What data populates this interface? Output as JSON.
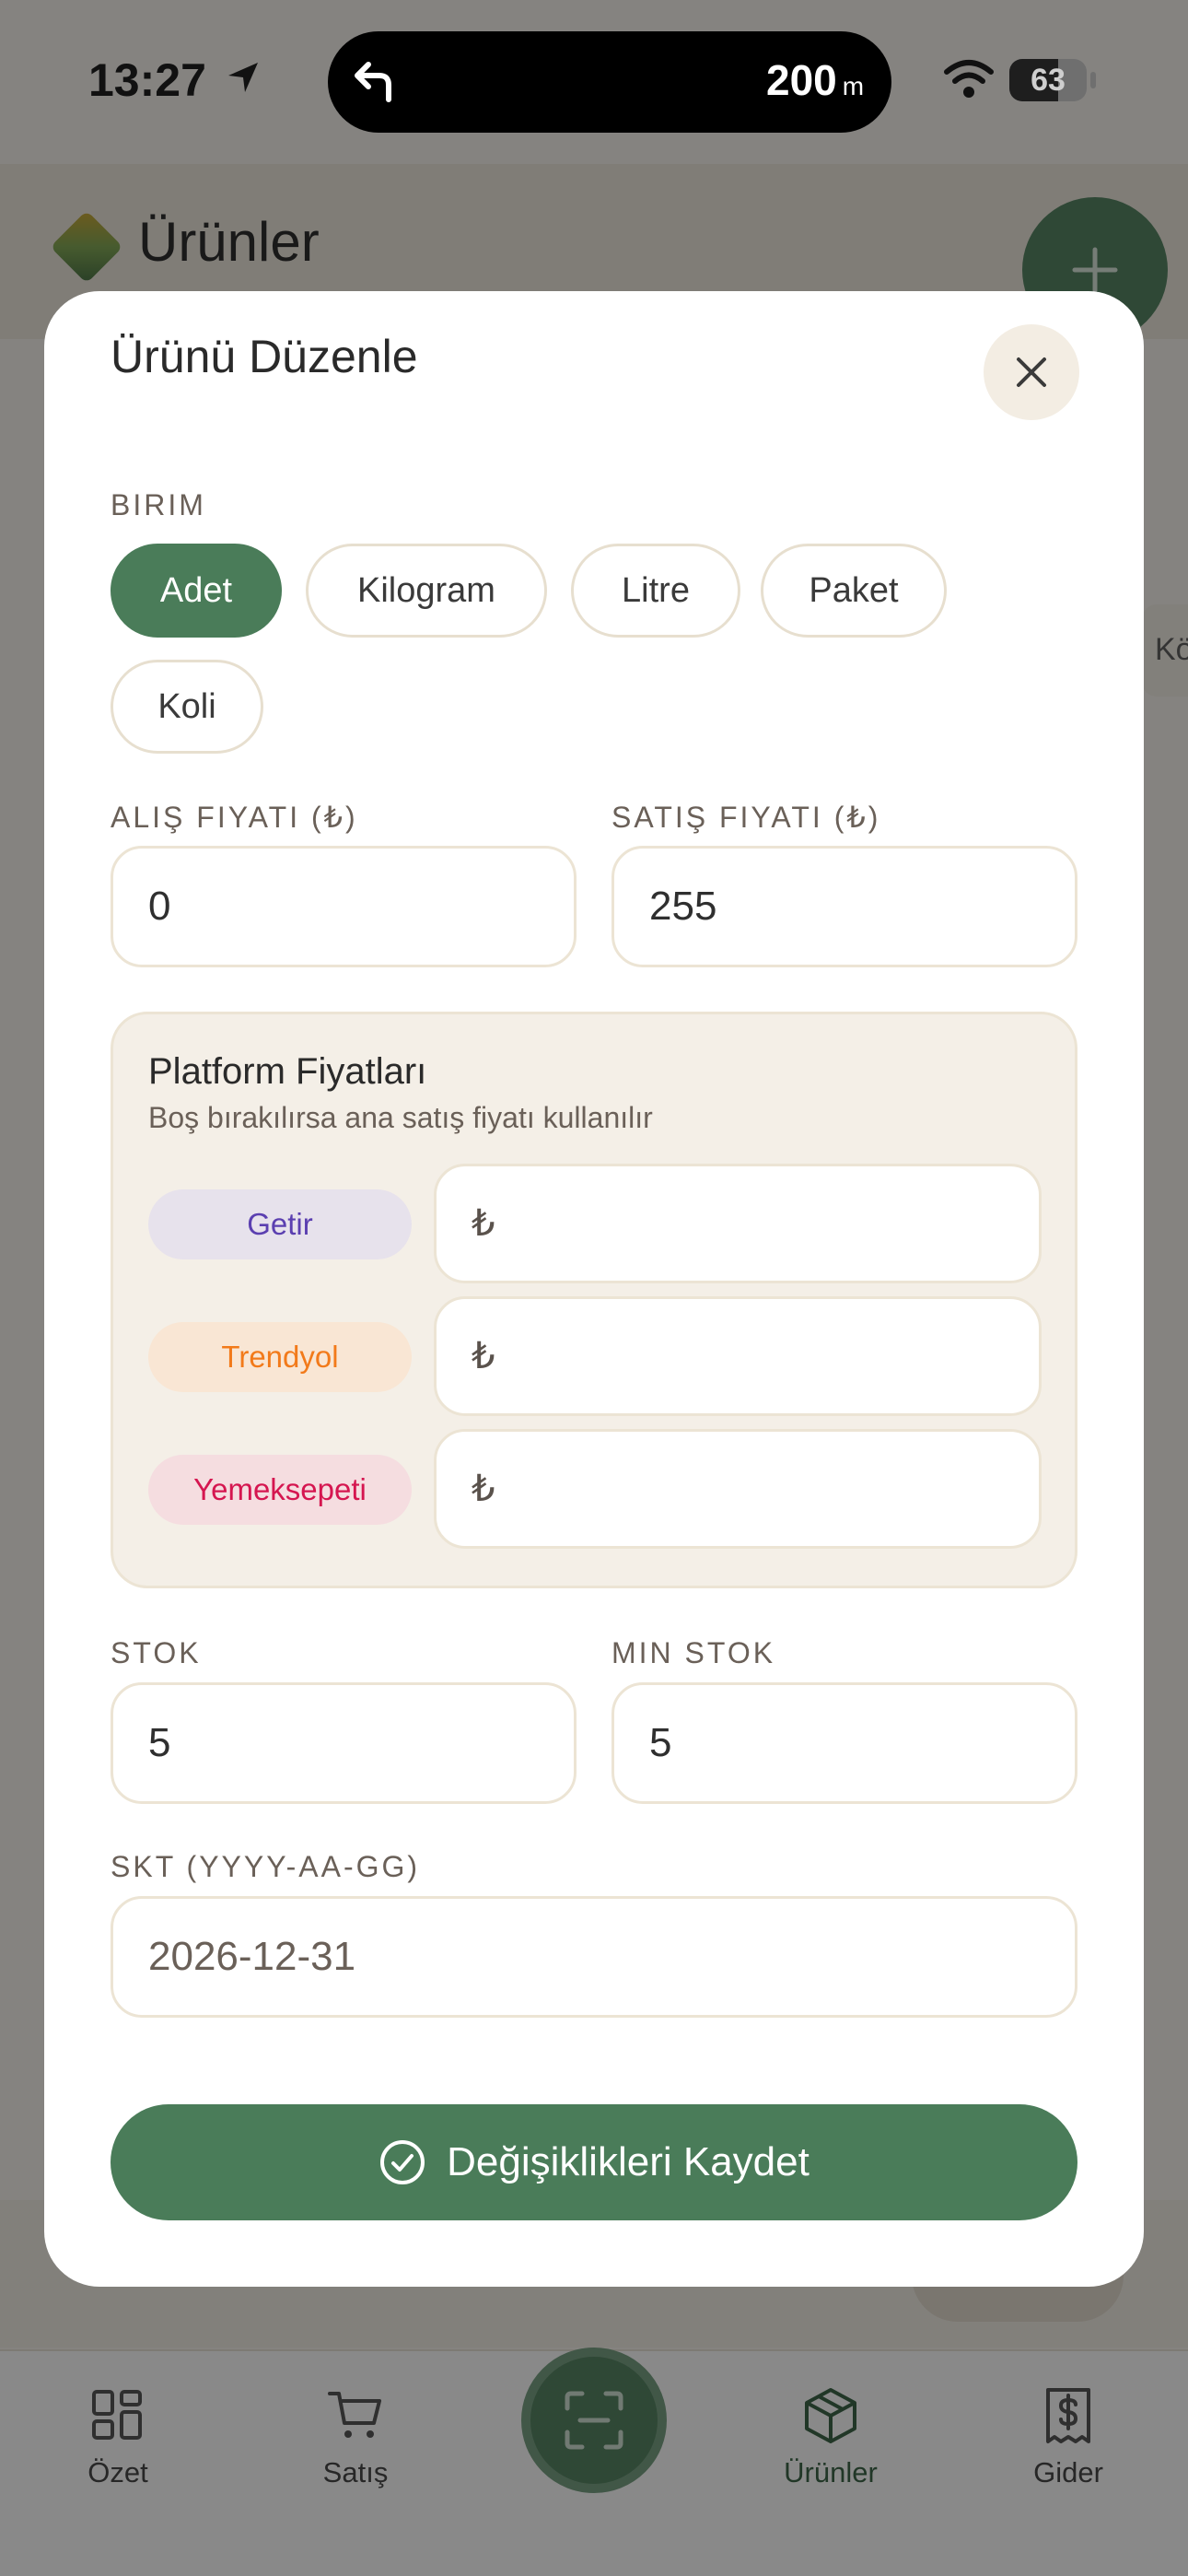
{
  "status_bar": {
    "time": "13:27",
    "nav_distance": "200",
    "nav_unit": "m",
    "battery": "63",
    "battery_fraction": 0.63
  },
  "background": {
    "header_title": "Ürünler",
    "peek_text": "Kö",
    "nav": [
      {
        "label": "Özet",
        "icon": "grid-icon"
      },
      {
        "label": "Satış",
        "icon": "cart-icon"
      },
      {
        "label": "",
        "icon": "scan-icon"
      },
      {
        "label": "Ürünler",
        "icon": "box-icon",
        "active": true
      },
      {
        "label": "Gider",
        "icon": "receipt-icon"
      }
    ]
  },
  "modal": {
    "title": "Ürünü Düzenle",
    "unit_label": "BIRIM",
    "units": [
      "Adet",
      "Kilogram",
      "Litre",
      "Paket",
      "Koli"
    ],
    "selected_unit": "Adet",
    "purchase_price_label": "ALIŞ FIYATI (₺)",
    "purchase_price": "0",
    "sale_price_label": "SATIŞ FIYATI (₺)",
    "sale_price": "255",
    "platform": {
      "title": "Platform Fiyatları",
      "subtitle": "Boş bırakılırsa ana satış fiyatı kullanılır",
      "items": [
        {
          "name": "Getir",
          "currency": "₺",
          "color": "#5b3fb0",
          "bg": "#e7e2ec"
        },
        {
          "name": "Trendyol",
          "currency": "₺",
          "color": "#f27a1a",
          "bg": "#f9e6d4"
        },
        {
          "name": "Yemeksepeti",
          "currency": "₺",
          "color": "#d51650",
          "bg": "#f5dde0"
        }
      ]
    },
    "stock_label": "STOK",
    "stock": "5",
    "min_stock_label": "MIN STOK",
    "min_stock": "5",
    "expiry_label": "SKT (YYYY-AA-GG)",
    "expiry": "2026-12-31",
    "save_label": "Değişiklikleri Kaydet"
  },
  "colors": {
    "accent": "#4a7c59",
    "modal_bg": "#ffffff",
    "panel_bg": "#f4efe7"
  }
}
